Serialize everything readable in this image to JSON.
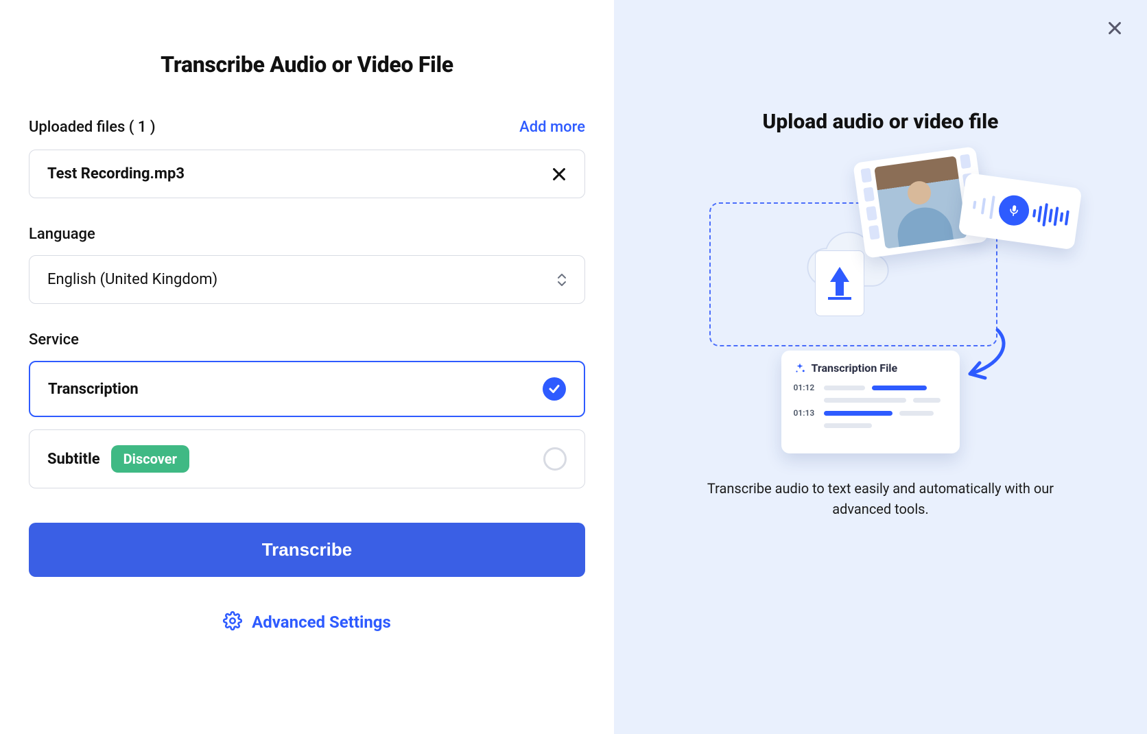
{
  "left": {
    "title": "Transcribe Audio or Video File",
    "uploaded": {
      "label": "Uploaded files ( 1 )",
      "add_more": "Add more",
      "file_name": "Test Recording.mp3"
    },
    "language": {
      "label": "Language",
      "value": "English (United Kingdom)"
    },
    "service": {
      "label": "Service",
      "options": {
        "transcription": {
          "name": "Transcription",
          "selected": true
        },
        "subtitle": {
          "name": "Subtitle",
          "selected": false,
          "badge": "Discover"
        }
      }
    },
    "cta": "Transcribe",
    "advanced": "Advanced Settings"
  },
  "right": {
    "title": "Upload audio or video file",
    "transcript_card": {
      "title": "Transcription File",
      "ts1": "01:12",
      "ts2": "01:13"
    },
    "desc": "Transcribe audio to text easily and automatically with our advanced tools."
  }
}
